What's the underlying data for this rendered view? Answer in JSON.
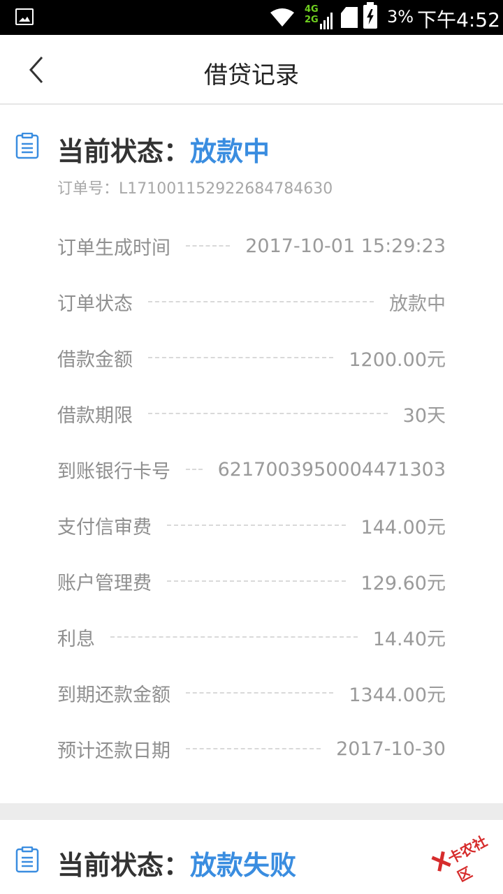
{
  "status_bar": {
    "network_top": "4G",
    "network_bottom": "2G",
    "battery_percent": "3%",
    "time": "下午4:52",
    "icons": [
      "image-icon",
      "wifi-icon",
      "signal-icon",
      "sim-icon",
      "battery-charging-icon"
    ]
  },
  "nav": {
    "back_icon": "chevron-left-icon",
    "title": "借贷记录"
  },
  "records": [
    {
      "status_label": "当前状态：",
      "status_value": "放款中",
      "order_no": "订单号：L17100115292268478463​0",
      "rows": [
        {
          "label": "订单生成时间",
          "value": "2017-10-01 15:29:23"
        },
        {
          "label": "订单状态",
          "value": "放款中"
        },
        {
          "label": "借款金额",
          "value": "1200.00元"
        },
        {
          "label": "借款期限",
          "value": "30天"
        },
        {
          "label": "到账银行卡号",
          "value": "6217003950004471303"
        },
        {
          "label": "支付信审费",
          "value": "144.00元"
        },
        {
          "label": "账户管理费",
          "value": "129.60元"
        },
        {
          "label": "利息",
          "value": "14.40元"
        },
        {
          "label": "到期还款金额",
          "value": "1344.00元"
        },
        {
          "label": "预计还款日期",
          "value": "2017-10-30"
        }
      ]
    },
    {
      "status_label": "当前状态：",
      "status_value": "放款失败"
    }
  ],
  "watermark": {
    "text": "卡农社区"
  },
  "colors": {
    "accent": "#3a8de0",
    "label": "#8f8f8f",
    "order_no": "#a8a8a8"
  }
}
